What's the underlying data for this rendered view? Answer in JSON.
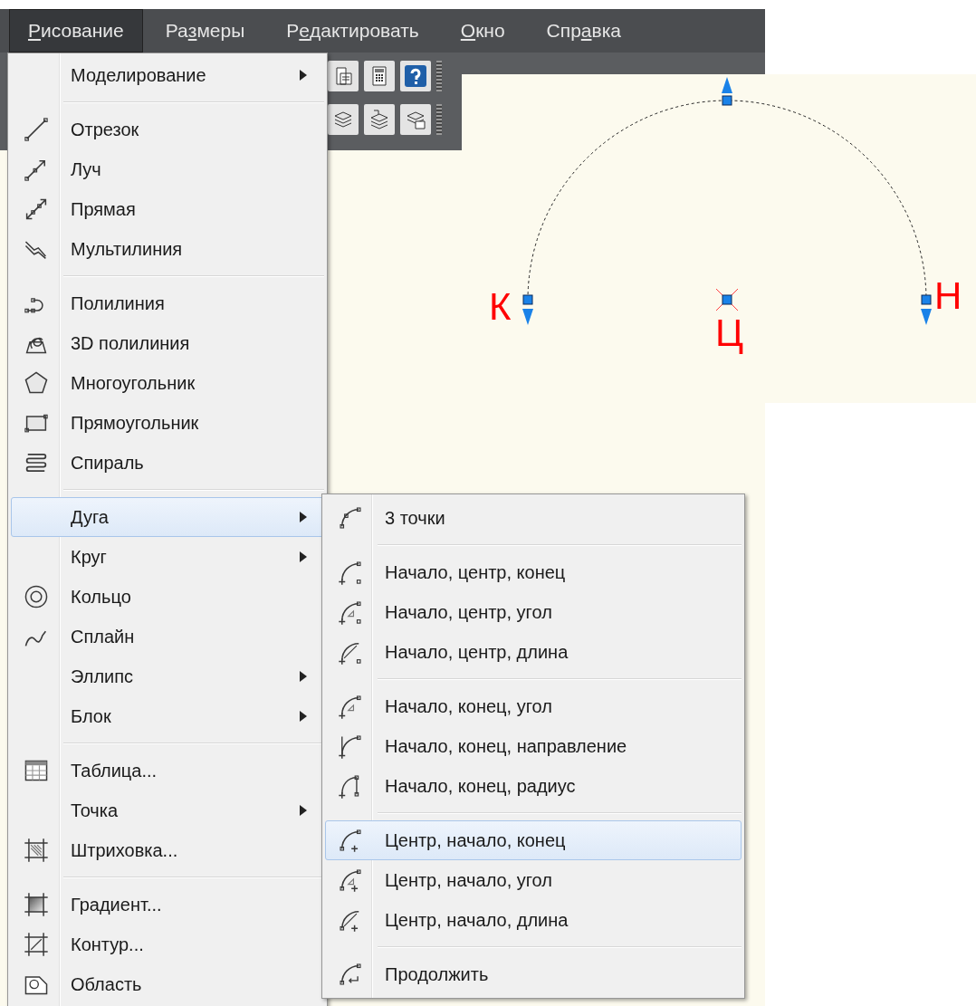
{
  "menubar": [
    {
      "key": "Р",
      "post": "исование",
      "selected": true
    },
    {
      "pre": "Ра",
      "key": "з",
      "post": "меры",
      "selected": false
    },
    {
      "pre": "Р",
      "key": "е",
      "post": "дактировать",
      "selected": false
    },
    {
      "key": "О",
      "post": "кно",
      "selected": false
    },
    {
      "pre": "Спр",
      "key": "а",
      "post": "вка",
      "selected": false
    }
  ],
  "draw_menu": {
    "groups": [
      {
        "items": [
          {
            "label": "Моделирование",
            "submenu": true,
            "selected": false
          }
        ]
      },
      {
        "items": [
          {
            "label": "Отрезок",
            "submenu": false,
            "selected": false
          },
          {
            "label": "Луч",
            "submenu": false,
            "selected": false
          },
          {
            "label": "Прямая",
            "submenu": false,
            "selected": false
          },
          {
            "label": "Мультилиния",
            "submenu": false,
            "selected": false
          }
        ]
      },
      {
        "items": [
          {
            "label": "Полилиния",
            "submenu": false,
            "selected": false
          },
          {
            "label": "3D полилиния",
            "submenu": false,
            "selected": false
          },
          {
            "label": "Многоугольник",
            "submenu": false,
            "selected": false
          },
          {
            "label": "Прямоугольник",
            "submenu": false,
            "selected": false
          },
          {
            "label": "Спираль",
            "submenu": false,
            "selected": false
          }
        ]
      },
      {
        "items": [
          {
            "label": "Дуга",
            "submenu": true,
            "selected": true
          },
          {
            "label": "Круг",
            "submenu": true,
            "selected": false
          },
          {
            "label": "Кольцо",
            "submenu": false,
            "selected": false
          },
          {
            "label": "Сплайн",
            "submenu": false,
            "selected": false
          },
          {
            "label": "Эллипс",
            "submenu": true,
            "selected": false
          },
          {
            "label": "Блок",
            "submenu": true,
            "selected": false
          }
        ]
      },
      {
        "items": [
          {
            "label": "Таблица...",
            "submenu": false,
            "selected": false
          },
          {
            "label": "Точка",
            "submenu": true,
            "selected": false
          },
          {
            "label": "Штриховка...",
            "submenu": false,
            "selected": false
          }
        ]
      },
      {
        "items": [
          {
            "label": "Градиент...",
            "submenu": false,
            "selected": false
          },
          {
            "label": "Контур...",
            "submenu": false,
            "selected": false
          },
          {
            "label": "Область",
            "submenu": false,
            "selected": false
          }
        ]
      }
    ]
  },
  "arc_submenu": {
    "groups": [
      {
        "items": [
          {
            "label": "3 точки",
            "selected": false
          }
        ]
      },
      {
        "items": [
          {
            "label": "Начало, центр, конец",
            "selected": false
          },
          {
            "label": "Начало, центр, угол",
            "selected": false
          },
          {
            "label": "Начало, центр, длина",
            "selected": false
          }
        ]
      },
      {
        "items": [
          {
            "label": "Начало, конец, угол",
            "selected": false
          },
          {
            "label": "Начало, конец, направление",
            "selected": false
          },
          {
            "label": "Начало, конец, радиус",
            "selected": false
          }
        ]
      },
      {
        "items": [
          {
            "label": "Центр, начало, конец",
            "selected": true
          },
          {
            "label": "Центр, начало, угол",
            "selected": false
          },
          {
            "label": "Центр, начало, длина",
            "selected": false
          }
        ]
      },
      {
        "items": [
          {
            "label": "Продолжить",
            "selected": false
          }
        ]
      }
    ]
  },
  "arc_preview": {
    "labels": [
      {
        "text": "К"
      },
      {
        "text": "Ц"
      },
      {
        "text": "Н"
      }
    ]
  }
}
